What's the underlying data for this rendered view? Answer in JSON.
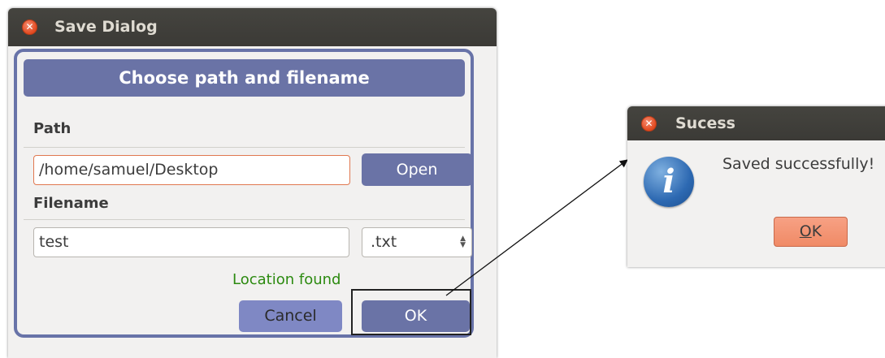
{
  "save_dialog": {
    "title": "Save Dialog",
    "header": "Choose path and filename",
    "path_label": "Path",
    "path_value": "/home/samuel/Desktop",
    "open_label": "Open",
    "filename_label": "Filename",
    "filename_value": "test",
    "extension_selected": ".txt",
    "status_text": "Location found",
    "cancel_label": "Cancel",
    "ok_label": "OK",
    "colors": {
      "accent": "#6a73a6",
      "status": "#2c8a10",
      "focus_border": "#e07850"
    }
  },
  "success_dialog": {
    "title": "Sucess",
    "message": "Saved successfully!",
    "ok_label": "OK",
    "icon": "info-icon",
    "colors": {
      "ok_button": "#f08a66"
    }
  }
}
